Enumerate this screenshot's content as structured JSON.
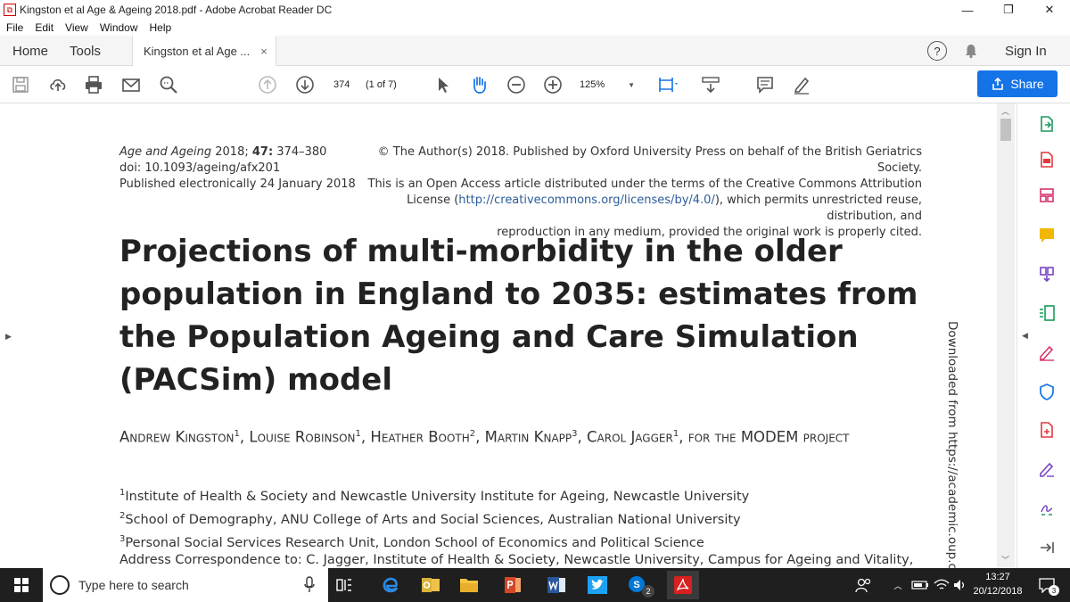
{
  "window": {
    "title": "Kingston et al Age & Ageing 2018.pdf - Adobe Acrobat Reader DC",
    "minimize": "—",
    "restore": "❐",
    "close": "✕"
  },
  "menu": [
    "File",
    "Edit",
    "View",
    "Window",
    "Help"
  ],
  "tabs": {
    "home": "Home",
    "tools": "Tools",
    "document": "Kingston et al Age ...",
    "close": "×",
    "help": "?",
    "sign_in": "Sign In"
  },
  "toolbar": {
    "page_value": "374",
    "page_count": "(1 of 7)",
    "zoom_value": "125%",
    "share_label": "Share"
  },
  "document": {
    "journal_name": "Age and Ageing",
    "journal_year": " 2018; ",
    "journal_volume": "47:",
    "journal_pages": " 374–380",
    "doi": "doi: 10.1093/ageing/afx201",
    "published": "Published electronically 24 January 2018",
    "copyright_line1": "© The Author(s) 2018. Published by Oxford University Press on behalf of the British Geriatrics Society.",
    "copyright_line2": "This is an Open Access article distributed under the terms of the Creative Commons Attribution",
    "copyright_line3_pre": "License (",
    "copyright_link": "http://creativecommons.org/licenses/by/4.0/",
    "copyright_line3_post": "), which permits unrestricted reuse, distribution, and",
    "copyright_line4": "reproduction in any medium, provided the original work is properly cited.",
    "title": "Projections of multi-morbidity in the older population in England to 2035: estimates from the Population Ageing and Care Simulation (PACSim) model",
    "authors": [
      {
        "name": "Andrew Kingston",
        "sup": "1",
        "sep": ", "
      },
      {
        "name": "Louise Robinson",
        "sup": "1",
        "sep": ", "
      },
      {
        "name": "Heather Booth",
        "sup": "2",
        "sep": ", "
      },
      {
        "name": "Martin Knapp",
        "sup": "3",
        "sep": ", "
      },
      {
        "name": "Carol Jagger",
        "sup": "1",
        "sep": ", "
      }
    ],
    "authors_tail": "for the MODEM project",
    "affiliations": [
      {
        "sup": "1",
        "text": "Institute of Health & Society and Newcastle University Institute for Ageing, Newcastle University"
      },
      {
        "sup": "2",
        "text": "School of Demography, ANU College of Arts and Social Sciences, Australian National University"
      },
      {
        "sup": "3",
        "text": "Personal Social Services Research Unit, London School of Economics and Political Science"
      }
    ],
    "correspondence": "Address Correspondence to: C. Jagger, Institute of Health & Society, Newcastle University, Campus for Ageing and Vitality,",
    "watermark": "Downloaded from https://academic.oup.com"
  },
  "taskbar": {
    "search_placeholder": "Type here to search",
    "skype_badge": "2",
    "time": "13:27",
    "date": "20/12/2018",
    "notification_count": "3"
  }
}
